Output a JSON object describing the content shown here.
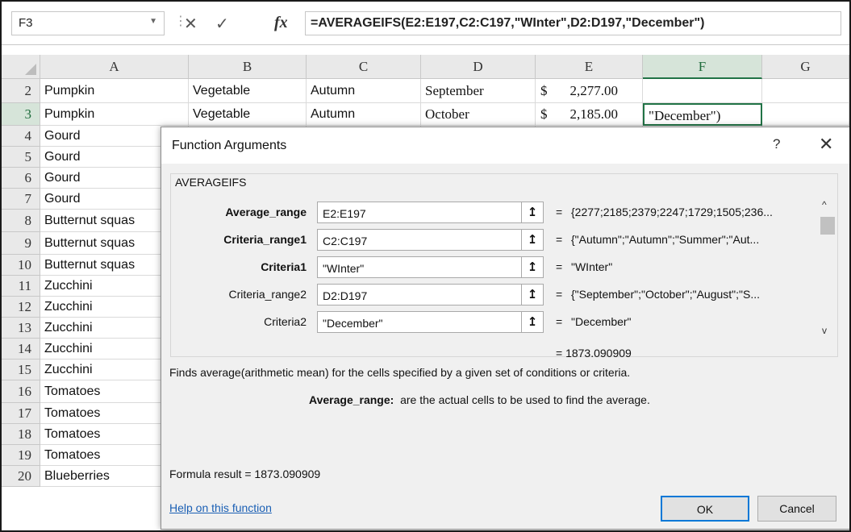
{
  "formula_bar": {
    "name_box": "F3",
    "cancel_icon": "x-icon",
    "enter_icon": "check-icon",
    "fx_label": "fx",
    "formula": "=AVERAGEIFS(E2:E197,C2:C197,\"WInter\",D2:D197,\"December\")"
  },
  "columns": [
    "A",
    "B",
    "C",
    "D",
    "E",
    "F",
    "G"
  ],
  "rows": [
    {
      "num": "2",
      "a": "Pumpkin",
      "b": "Vegetable",
      "c": "Autumn",
      "d": "September",
      "e_sym": "$",
      "e_amt": "2,277.00",
      "f": ""
    },
    {
      "num": "3",
      "a": "Pumpkin",
      "b": "Vegetable",
      "c": "Autumn",
      "d": "October",
      "e_sym": "$",
      "e_amt": "2,185.00",
      "f": "\"December\")"
    },
    {
      "num": "4",
      "a": "Gourd"
    },
    {
      "num": "5",
      "a": "Gourd"
    },
    {
      "num": "6",
      "a": "Gourd"
    },
    {
      "num": "7",
      "a": "Gourd"
    },
    {
      "num": "8",
      "a": "Butternut squas"
    },
    {
      "num": "9",
      "a": "Butternut squas"
    },
    {
      "num": "10",
      "a": "Butternut squas"
    },
    {
      "num": "11",
      "a": "Zucchini"
    },
    {
      "num": "12",
      "a": "Zucchini"
    },
    {
      "num": "13",
      "a": "Zucchini"
    },
    {
      "num": "14",
      "a": "Zucchini"
    },
    {
      "num": "15",
      "a": "Zucchini"
    },
    {
      "num": "16",
      "a": "Tomatoes"
    },
    {
      "num": "17",
      "a": "Tomatoes"
    },
    {
      "num": "18",
      "a": "Tomatoes"
    },
    {
      "num": "19",
      "a": "Tomatoes"
    },
    {
      "num": "20",
      "a": "Blueberries"
    }
  ],
  "dialog": {
    "title": "Function Arguments",
    "help_glyph": "?",
    "close_glyph": "✕",
    "function_name": "AVERAGEIFS",
    "args": [
      {
        "label": "Average_range",
        "bold": true,
        "value": "E2:E197",
        "eq": "=",
        "result": "{2277;2185;2379;2247;1729;1505;236..."
      },
      {
        "label": "Criteria_range1",
        "bold": true,
        "value": "C2:C197",
        "eq": "=",
        "result": "{\"Autumn\";\"Autumn\";\"Summer\";\"Aut..."
      },
      {
        "label": "Criteria1",
        "bold": true,
        "value": "\"WInter\"",
        "eq": "=",
        "result": "\"WInter\""
      },
      {
        "label": "Criteria_range2",
        "bold": false,
        "value": "D2:D197",
        "eq": "=",
        "result": "{\"September\";\"October\";\"August\";\"S..."
      },
      {
        "label": "Criteria2",
        "bold": false,
        "value": "\"December\"",
        "eq": "=",
        "result": "\"December\""
      }
    ],
    "overall_result": "=  1873.090909",
    "description": "Finds average(arithmetic mean) for the cells specified by a given set of conditions or criteria.",
    "arg_desc_name": "Average_range:",
    "arg_desc_text": "are the actual cells to be used to find the average.",
    "formula_result": "Formula result =   1873.090909",
    "help_link": "Help on this function",
    "ok_label": "OK",
    "cancel_label": "Cancel"
  }
}
